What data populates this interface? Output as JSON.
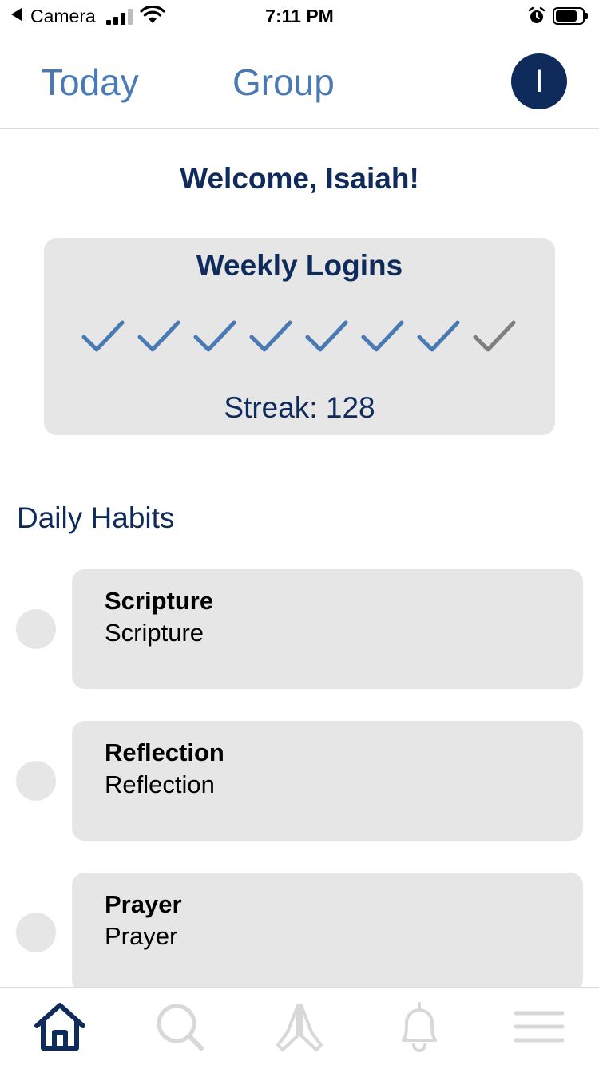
{
  "status_bar": {
    "carrier": "Camera",
    "time": "7:11 PM"
  },
  "header": {
    "tabs": [
      {
        "label": "Today"
      },
      {
        "label": "Group"
      }
    ],
    "avatar_initial": "I",
    "avatar_color": "#0f2b5b"
  },
  "welcome": "Welcome, Isaiah!",
  "weekly_logins": {
    "title": "Weekly Logins",
    "checks": [
      "checked",
      "checked",
      "checked",
      "checked",
      "checked",
      "checked",
      "checked",
      "unchecked"
    ],
    "streak_text": "Streak: 128"
  },
  "daily_habits": {
    "title": "Daily Habits",
    "items": [
      {
        "title": "Scripture",
        "subtitle": "Scripture"
      },
      {
        "title": "Reflection",
        "subtitle": "Reflection"
      },
      {
        "title": "Prayer",
        "subtitle": "Prayer"
      }
    ]
  },
  "bottom_nav": {
    "items": [
      {
        "icon": "home-icon",
        "active": true
      },
      {
        "icon": "search-icon",
        "active": false
      },
      {
        "icon": "praying-hands-icon",
        "active": false
      },
      {
        "icon": "bell-icon",
        "active": false
      },
      {
        "icon": "menu-icon",
        "active": false
      }
    ]
  },
  "colors": {
    "primary": "#0f2b5b",
    "accent": "#4a7ab4",
    "card": "#e6e6e6",
    "inactive_icon": "#d8d8d8"
  }
}
